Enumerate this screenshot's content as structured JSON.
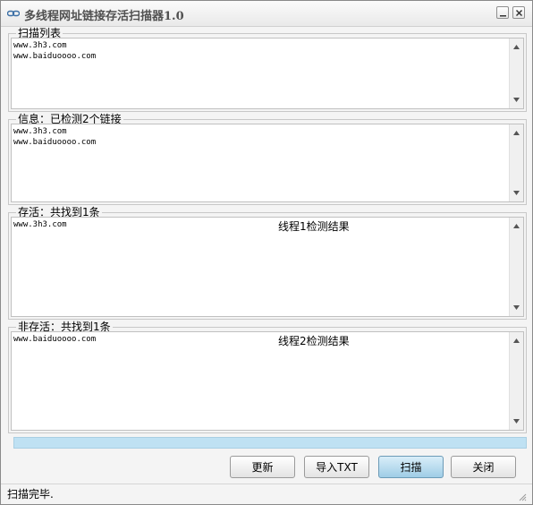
{
  "window": {
    "title": "多线程网址链接存活扫描器1.0"
  },
  "scan_list": {
    "legend": "扫描列表",
    "lines": "www.3h3.com\nwww.baiduoooo.com"
  },
  "info": {
    "legend": "信息：已检测2个链接",
    "lines": "www.3h3.com\nwww.baiduoooo.com"
  },
  "alive": {
    "legend": "存活：共找到1条",
    "lines": "www.3h3.com",
    "thread_result": "线程1检测结果"
  },
  "dead": {
    "legend": "非存活：共找到1条",
    "lines": "www.baiduoooo.com",
    "thread_result": "线程2检测结果"
  },
  "progress": {
    "value": 1.0,
    "color": "#bfe1f3"
  },
  "buttons": {
    "refresh": "更新",
    "import": "导入TXT",
    "scan": "扫描",
    "close": "关闭"
  },
  "status": {
    "text": "扫描完毕."
  },
  "icons": {
    "app": "link-icon",
    "minimize": "minimize-icon",
    "close": "close-icon",
    "scroll_up": "arrow-up-icon",
    "scroll_down": "arrow-down-icon",
    "resize": "resize-grip-icon"
  }
}
